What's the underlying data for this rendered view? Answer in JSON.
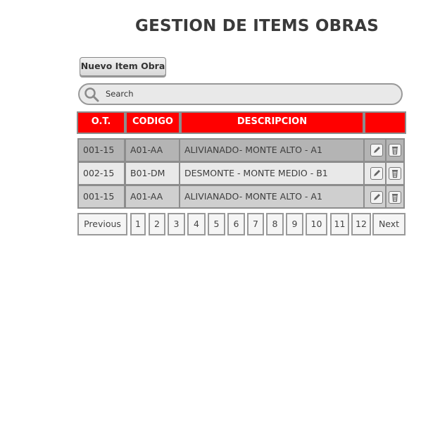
{
  "page": {
    "title": "GESTION DE ITEMS OBRAS",
    "new_button": "Nuevo Item Obra"
  },
  "search": {
    "placeholder": "Search",
    "icon": "search-icon"
  },
  "table": {
    "headers": [
      "O.T.",
      "CODIGO",
      "DESCRIPCION",
      ""
    ],
    "rows": [
      {
        "ot": "001-15",
        "codigo": "A01-AA",
        "descripcion": "ALIVIANADO- MONTE ALTO - A1"
      },
      {
        "ot": "002-15",
        "codigo": "B01-DM",
        "descripcion": "DESMONTE - MONTE MEDIO - B1"
      },
      {
        "ot": "001-15",
        "codigo": "A01-AA",
        "descripcion": "ALIVIANADO- MONTE ALTO - A1"
      }
    ],
    "row_actions": [
      "edit-icon",
      "trash-icon"
    ]
  },
  "pagination": {
    "previous": "Previous",
    "pages": [
      "1",
      "2",
      "3",
      "4",
      "5",
      "6",
      "7",
      "8",
      "9",
      "10",
      "11",
      "12"
    ],
    "next": "Next"
  },
  "colors": {
    "header_bg": "#ff0000",
    "row_dark": "#b4b4b4",
    "row_light": "#e9e9e9",
    "row_mid": "#cfcfcf"
  }
}
